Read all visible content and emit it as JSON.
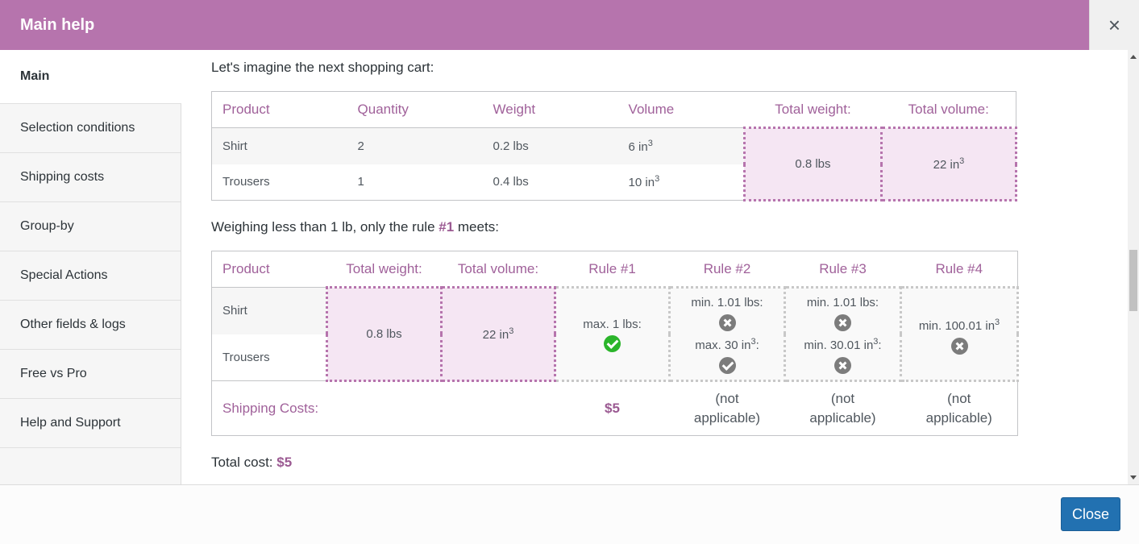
{
  "header": {
    "title": "Main help",
    "close_icon": "×"
  },
  "sidebar": {
    "items": [
      {
        "label": "Main"
      },
      {
        "label": "Selection conditions"
      },
      {
        "label": "Shipping costs"
      },
      {
        "label": "Group-by"
      },
      {
        "label": "Special Actions"
      },
      {
        "label": "Other fields & logs"
      },
      {
        "label": "Free vs Pro"
      },
      {
        "label": "Help and Support"
      }
    ]
  },
  "content": {
    "intro": "Let's imagine the next shopping cart:",
    "cart_table": {
      "headers": [
        "Product",
        "Quantity",
        "Weight",
        "Volume",
        "Total weight:",
        "Total volume:"
      ],
      "rows": [
        {
          "product": "Shirt",
          "quantity": "2",
          "weight": "0.2 lbs",
          "volume": "6 in",
          "volume_sup": "3"
        },
        {
          "product": "Trousers",
          "quantity": "1",
          "weight": "0.4 lbs",
          "volume": "10 in",
          "volume_sup": "3"
        }
      ],
      "total_weight": "0.8 lbs",
      "total_volume": "22 in",
      "total_volume_sup": "3"
    },
    "rule_sentence": {
      "before": "Weighing less than 1 lb, only the rule ",
      "highlight": "#1",
      "after": " meets:"
    },
    "rule_table": {
      "headers": [
        "Product",
        "Total weight:",
        "Total volume:",
        "Rule #1",
        "Rule #2",
        "Rule #3",
        "Rule #4"
      ],
      "products": [
        "Shirt",
        "Trousers"
      ],
      "total_weight": "0.8 lbs",
      "total_volume": "22 in",
      "total_volume_sup": "3",
      "rule1": {
        "cond": "max. 1 lbs:",
        "status": "check-icon"
      },
      "rule2": {
        "cond1": "min. 1.01 lbs:",
        "status1": "x-icon",
        "cond2a": "max. 30 in",
        "cond2b": ":",
        "status2": "check-icon"
      },
      "rule3": {
        "cond1": "min. 1.01 lbs:",
        "status1": "x-icon",
        "cond2a": "min. 30.01 in",
        "cond2b": ":",
        "status2": "x-icon"
      },
      "rule4": {
        "cond": "min. 100.01 in",
        "status": "x-icon"
      },
      "sup": "3",
      "shipping_label": "Shipping Costs:",
      "shipping_rule1": "$5",
      "not_applicable_1": "(not",
      "not_applicable_2": "applicable)"
    },
    "total": {
      "label": "Total cost: ",
      "value": "$5"
    }
  },
  "footer": {
    "close_label": "Close"
  },
  "colors": {
    "header_bg": "#b674ad",
    "accent_text": "#a0619a",
    "button_bg": "#2271b1",
    "ok_icon": "#2bb52b"
  }
}
